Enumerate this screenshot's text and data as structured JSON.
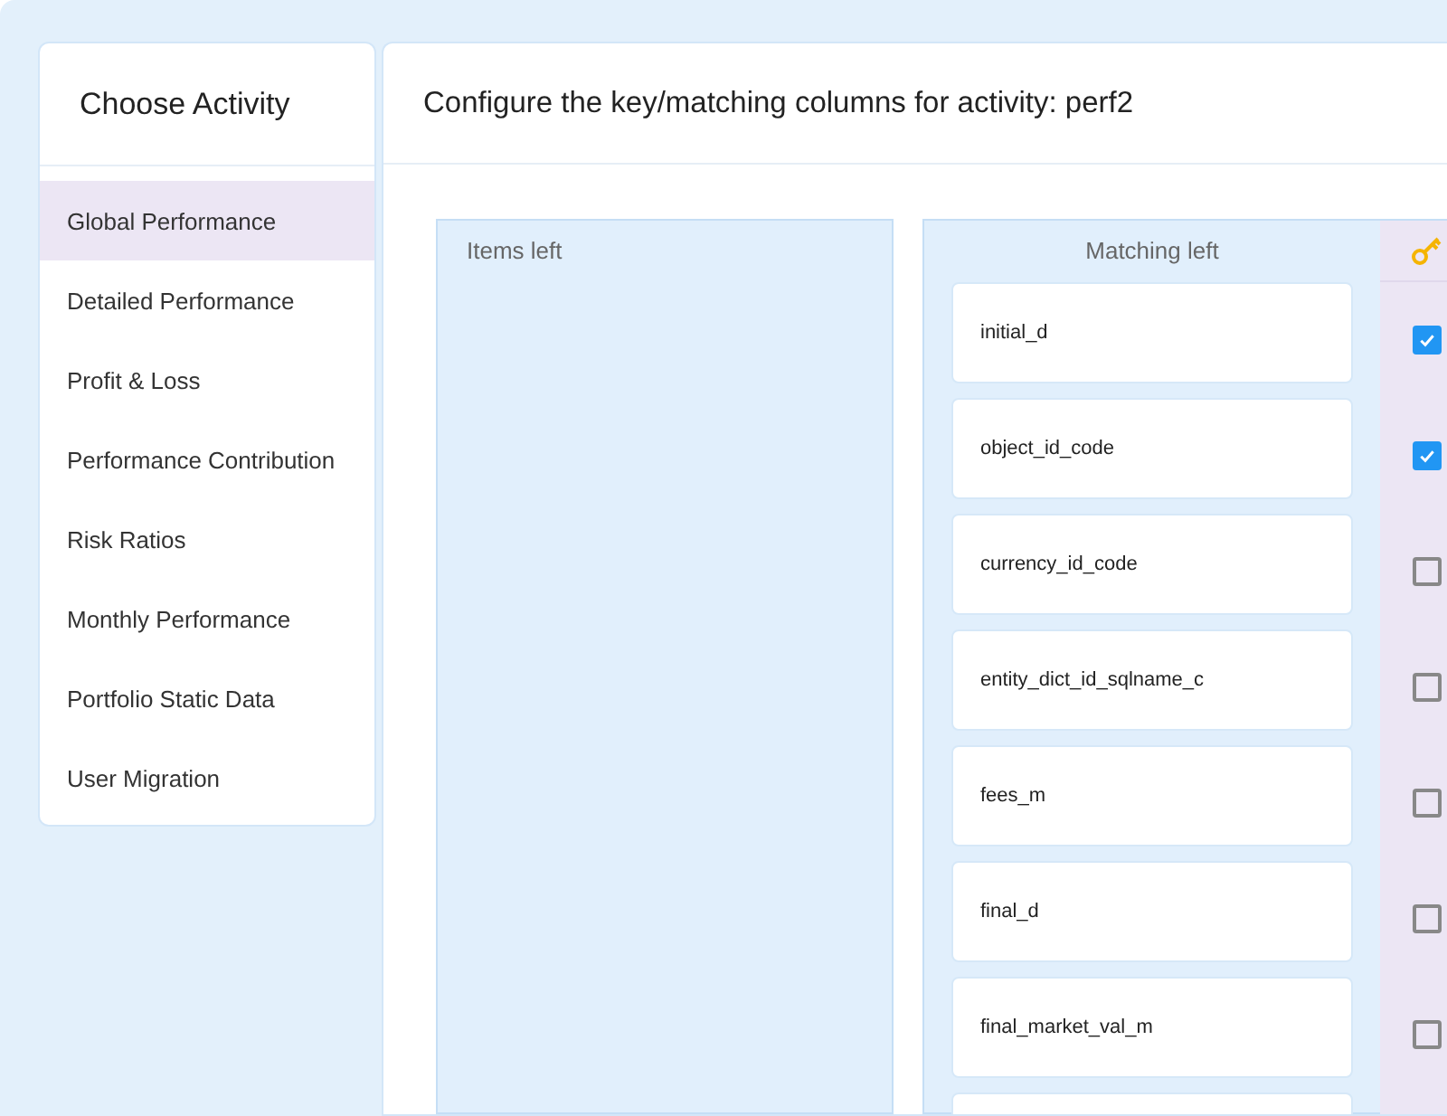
{
  "sidebar": {
    "title": "Choose Activity",
    "items": [
      {
        "label": "Global Performance",
        "selected": true
      },
      {
        "label": "Detailed Performance",
        "selected": false
      },
      {
        "label": "Profit & Loss",
        "selected": false
      },
      {
        "label": "Performance Contribution",
        "selected": false
      },
      {
        "label": "Risk Ratios",
        "selected": false
      },
      {
        "label": "Monthly Performance",
        "selected": false
      },
      {
        "label": "Portfolio Static Data",
        "selected": false
      },
      {
        "label": "User Migration",
        "selected": false
      }
    ]
  },
  "main": {
    "title": "Configure the key/matching columns for activity: perf2",
    "items_left": {
      "title": "Items left"
    },
    "matching_left": {
      "title": "Matching left",
      "rows": [
        {
          "label": "initial_d",
          "checked": true
        },
        {
          "label": "object_id_code",
          "checked": true
        },
        {
          "label": "currency_id_code",
          "checked": false
        },
        {
          "label": "entity_dict_id_sqlname_c",
          "checked": false
        },
        {
          "label": "fees_m",
          "checked": false
        },
        {
          "label": "final_d",
          "checked": false
        },
        {
          "label": "final_market_val_m",
          "checked": false
        }
      ]
    }
  }
}
